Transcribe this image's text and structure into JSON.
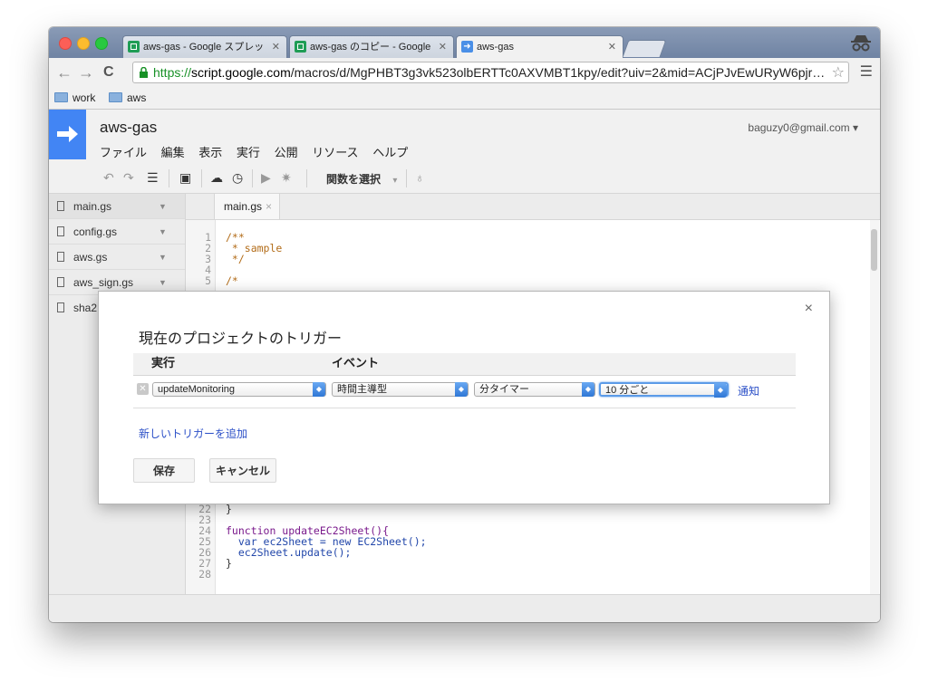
{
  "browser": {
    "tabs": [
      {
        "label": "aws-gas - Google スプレッ",
        "icon": "sheets-icon"
      },
      {
        "label": "aws-gas のコピー - Google",
        "icon": "sheets-icon"
      },
      {
        "label": "aws-gas",
        "icon": "apps-script-icon"
      }
    ],
    "url_scheme": "https://",
    "url_host": "script.google.com",
    "url_path": "/macros/d/MgPHBT3g3vk523olbERTTc0AXVMBT1kpy/edit?uiv=2&mid=ACjPJvEwURyW6pjr…",
    "bookmarks": [
      "work",
      "aws"
    ]
  },
  "app": {
    "project_title": "aws-gas",
    "account": "baguzy0@gmail.com ▾",
    "menus": [
      "ファイル",
      "編集",
      "表示",
      "実行",
      "公開",
      "リソース",
      "ヘルプ"
    ],
    "function_select": "関数を選択"
  },
  "files": [
    "main.gs",
    "config.gs",
    "aws.gs",
    "aws_sign.gs",
    "sha2"
  ],
  "editor": {
    "tab_label": "main.gs",
    "top_lines": [
      {
        "n": "1",
        "text": "/**"
      },
      {
        "n": "2",
        "text": " * sample"
      },
      {
        "n": "3",
        "text": " */"
      },
      {
        "n": "4",
        "text": ""
      },
      {
        "n": "5",
        "text": "/*"
      }
    ],
    "bottom_lines": [
      {
        "n": "22",
        "text": "}"
      },
      {
        "n": "23",
        "text": ""
      },
      {
        "n": "24",
        "text": "function updateEC2Sheet(){"
      },
      {
        "n": "25",
        "text": "  var ec2Sheet = new EC2Sheet();"
      },
      {
        "n": "26",
        "text": "  ec2Sheet.update();"
      },
      {
        "n": "27",
        "text": "}"
      },
      {
        "n": "28",
        "text": ""
      }
    ]
  },
  "dialog": {
    "title": "現在のプロジェクトのトリガー",
    "col_run": "実行",
    "col_event": "イベント",
    "function_value": "updateMonitoring",
    "event_type": "時間主導型",
    "timer_type": "分タイマー",
    "interval": "10 分ごと",
    "notify_label": "通知",
    "add_trigger": "新しいトリガーを追加",
    "save_label": "保存",
    "cancel_label": "キャンセル",
    "close": "×"
  }
}
